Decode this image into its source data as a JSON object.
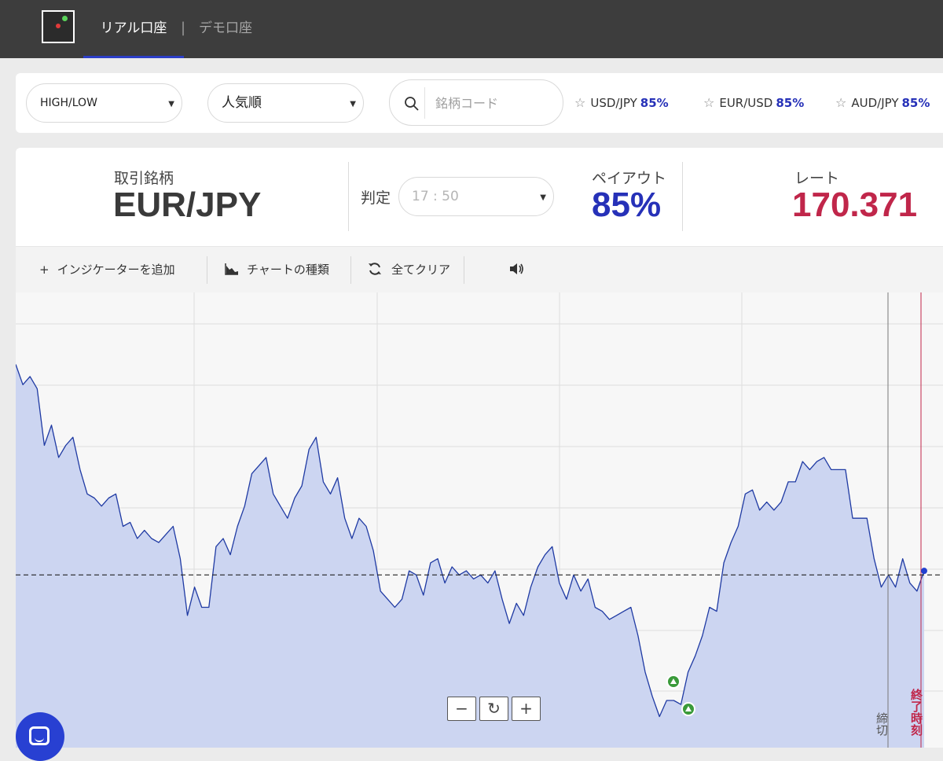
{
  "nav": {
    "tab_real": "リアル口座",
    "separator": "|",
    "tab_demo": "デモ口座"
  },
  "filters": {
    "type_select": "HIGH/LOW",
    "sort_select": "人気順",
    "search_placeholder": "銘柄コード",
    "favorites": [
      {
        "pair": "USD/JPY",
        "payout": "85%"
      },
      {
        "pair": "EUR/USD",
        "payout": "85%"
      },
      {
        "pair": "AUD/JPY",
        "payout": "85%"
      }
    ]
  },
  "info": {
    "symbol_label": "取引銘柄",
    "symbol": "EUR/JPY",
    "judge_label": "判定",
    "judge_time": "17 : 50",
    "payout_label": "ペイアウト",
    "payout": "85%",
    "rate_label": "レート",
    "rate": "170.371",
    "payout_color": "#2631b8",
    "rate_color": "#c0264a"
  },
  "toolbar": {
    "add_indicator": "インジケーターを追加",
    "chart_type": "チャートの種類",
    "clear_all": "全てクリア"
  },
  "chart_data": {
    "type": "area",
    "y": [
      0.9,
      0.85,
      0.87,
      0.84,
      0.7,
      0.75,
      0.67,
      0.7,
      0.72,
      0.64,
      0.58,
      0.57,
      0.55,
      0.57,
      0.58,
      0.5,
      0.51,
      0.47,
      0.49,
      0.47,
      0.46,
      0.48,
      0.5,
      0.42,
      0.28,
      0.35,
      0.3,
      0.3,
      0.45,
      0.47,
      0.43,
      0.5,
      0.55,
      0.63,
      0.65,
      0.67,
      0.58,
      0.55,
      0.52,
      0.57,
      0.6,
      0.69,
      0.72,
      0.61,
      0.58,
      0.62,
      0.52,
      0.47,
      0.52,
      0.5,
      0.44,
      0.34,
      0.32,
      0.3,
      0.32,
      0.39,
      0.38,
      0.33,
      0.41,
      0.42,
      0.36,
      0.4,
      0.38,
      0.39,
      0.37,
      0.38,
      0.36,
      0.39,
      0.32,
      0.26,
      0.31,
      0.28,
      0.35,
      0.4,
      0.43,
      0.45,
      0.36,
      0.32,
      0.38,
      0.34,
      0.37,
      0.3,
      0.29,
      0.27,
      0.28,
      0.29,
      0.3,
      0.23,
      0.14,
      0.08,
      0.03,
      0.07,
      0.07,
      0.06,
      0.14,
      0.18,
      0.23,
      0.3,
      0.29,
      0.41,
      0.46,
      0.5,
      0.58,
      0.59,
      0.54,
      0.56,
      0.54,
      0.56,
      0.61,
      0.61,
      0.66,
      0.64,
      0.66,
      0.67,
      0.64,
      0.64,
      0.64,
      0.52,
      0.52,
      0.52,
      0.42,
      0.35,
      0.38,
      0.35,
      0.42,
      0.36,
      0.34,
      0.39
    ],
    "reference_level": 0.38,
    "cutoff_label": "締切",
    "end_label": "終了時刻",
    "zoom_out": "−",
    "zoom_reset": "↻",
    "zoom_in": "+",
    "fill_color": "#ccd5f1",
    "line_color": "#1f3aa3"
  }
}
